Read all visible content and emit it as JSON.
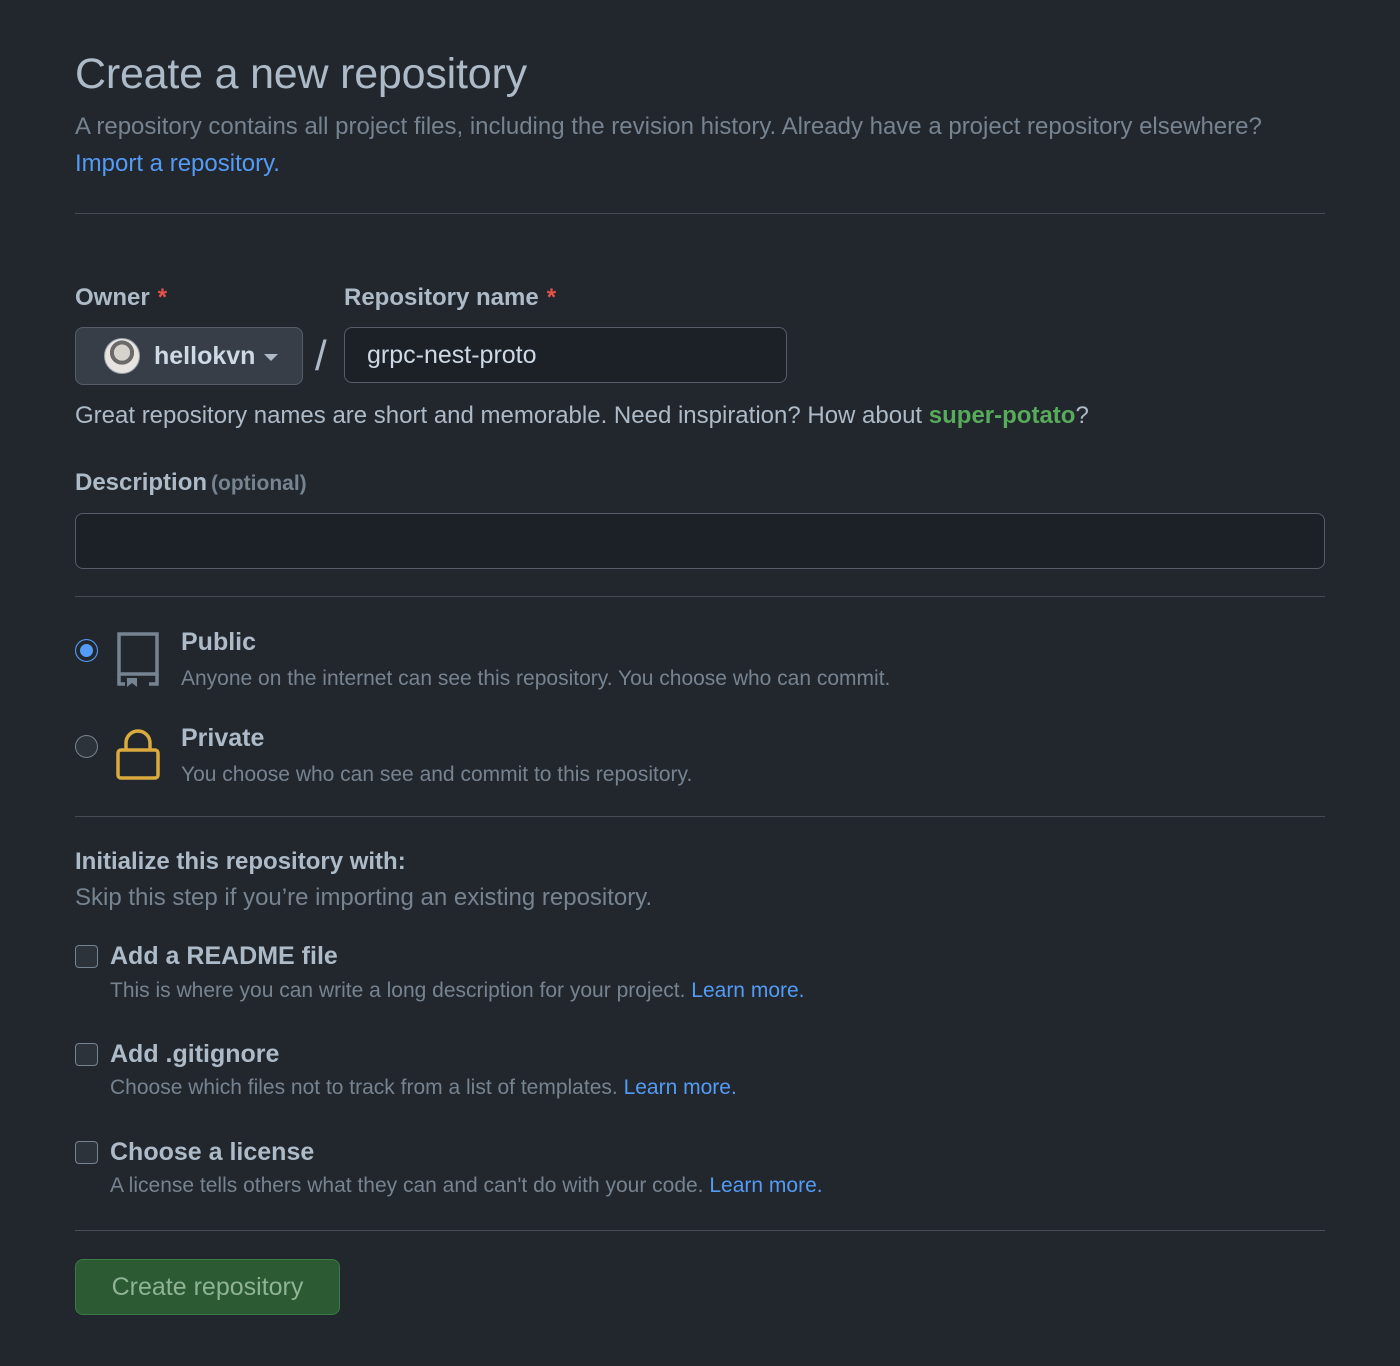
{
  "header": {
    "title": "Create a new repository",
    "subtitle": "A repository contains all project files, including the revision history. Already have a project repository elsewhere?",
    "import_link": "Import a repository."
  },
  "form": {
    "owner_label": "Owner",
    "owner_value": "hellokvn",
    "separator": "/",
    "repo_name_label": "Repository name",
    "repo_name_value": "grpc-nest-proto",
    "required_mark": "*",
    "name_hint": "Great repository names are short and memorable. Need inspiration? How about",
    "name_suggestion": "super-potato",
    "name_hint_end": "?",
    "description_label": "Description",
    "description_optional": "(optional)",
    "description_value": ""
  },
  "visibility": {
    "selected": "public",
    "public": {
      "title": "Public",
      "description": "Anyone on the internet can see this repository. You choose who can commit.",
      "icon": "repo-icon"
    },
    "private": {
      "title": "Private",
      "description": "You choose who can see and commit to this repository.",
      "icon": "lock-icon"
    }
  },
  "initialize": {
    "title": "Initialize this repository with:",
    "subtitle": "Skip this step if you’re importing an existing repository.",
    "options": [
      {
        "title": "Add a README file",
        "description": "This is where you can write a long description for your project.",
        "link": "Learn more.",
        "checked": false
      },
      {
        "title": "Add .gitignore",
        "description": "Choose which files not to track from a list of templates.",
        "link": "Learn more.",
        "checked": false
      },
      {
        "title": "Choose a license",
        "description": "A license tells others what they can and can't do with your code.",
        "link": "Learn more.",
        "checked": false
      }
    ]
  },
  "actions": {
    "create_label": "Create repository"
  },
  "colors": {
    "background": "#22272e",
    "link": "#539bf5",
    "suggestion": "#57ab5a",
    "required": "#e5534b",
    "lock": "#daaa3f",
    "create_button": "#2b5a33"
  }
}
